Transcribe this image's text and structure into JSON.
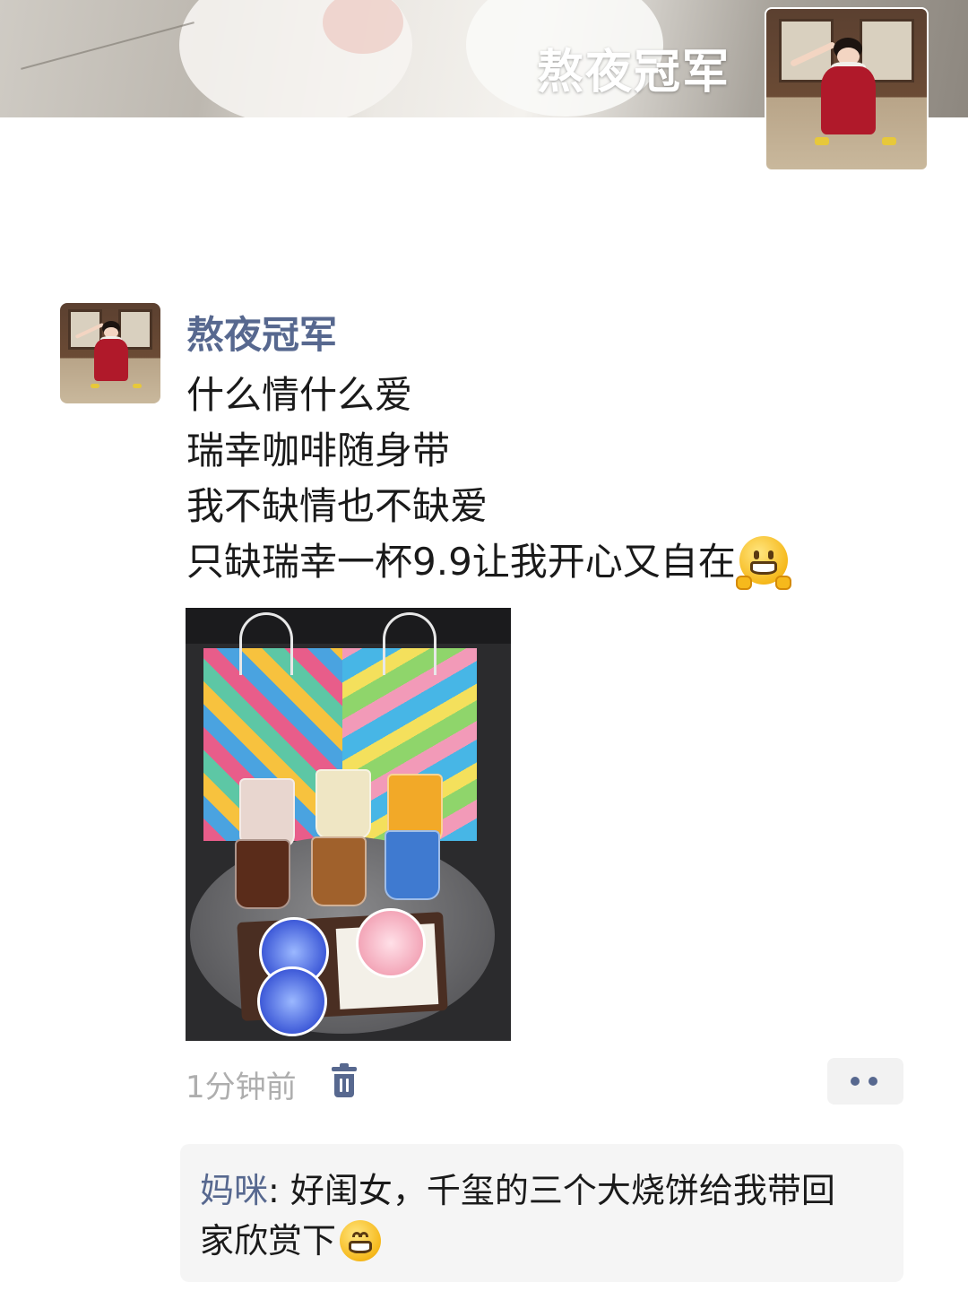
{
  "cover": {
    "name": "熬夜冠军"
  },
  "post": {
    "author": "熬夜冠军",
    "lines": [
      "什么情什么爱",
      "瑞幸咖啡随身带",
      "我不缺情也不缺爱",
      "只缺瑞幸一杯9.9让我开心又自在"
    ],
    "emoji": "grinning-with-hands-emoji",
    "time": "1分钟前"
  },
  "comments": [
    {
      "author": "妈咪",
      "separator": ": ",
      "text_line1": "好闺女，千玺的三个大烧饼给我带回",
      "text_line2": "家欣赏下",
      "emoji": "beaming-face-emoji"
    }
  ],
  "icons": {
    "delete": "trash-icon",
    "more": "more-dots-icon"
  },
  "colors": {
    "name_link": "#57688f",
    "time_gray": "#aeaeae",
    "comment_bg": "#f5f5f5"
  }
}
